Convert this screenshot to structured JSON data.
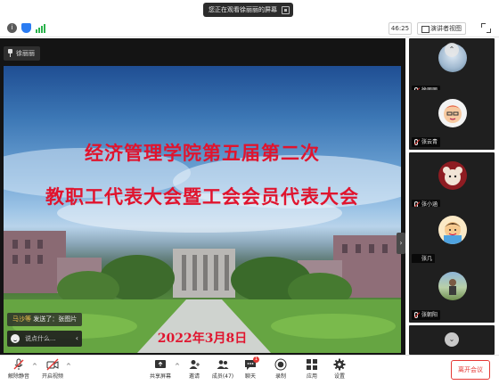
{
  "share_banner": {
    "text": "您正在观看徐丽丽的屏幕"
  },
  "status_bar": {
    "timer": "46:25",
    "view_mode": "演讲者视图"
  },
  "stage": {
    "viewing_tag": "徐丽丽",
    "slide": {
      "title_line1": "经济管理学院第五届第二次",
      "title_line2": "教职工代表大会暨工会会员代表大会",
      "date": "2022年3月8日"
    },
    "chat_toast": {
      "sender": "马沙等",
      "text": "发送了：张图片"
    },
    "chat_input_placeholder": "说点什么...",
    "collapse_glyph": "›"
  },
  "gallery": {
    "tiles": [
      {
        "name": "徐丽丽"
      },
      {
        "name": "张云青"
      },
      {
        "name": "张小涵"
      },
      {
        "name": "张几"
      },
      {
        "name": "张朝阳"
      },
      {
        "name": ""
      }
    ],
    "scroll_up_glyph": "⌃",
    "scroll_down_glyph": "⌄"
  },
  "toolbar": {
    "mute": "解除静音",
    "video": "开启视频",
    "share": "共享屏幕",
    "invite": "邀请",
    "participants": "成员(47)",
    "chat": "聊天",
    "chat_badge": "1",
    "record": "录制",
    "apps": "应用",
    "settings": "设置",
    "leave": "离开会议"
  },
  "colors": {
    "accent_red": "#e53935",
    "title_red": "#e0142e",
    "chrome_dark": "#1f1f1f"
  }
}
